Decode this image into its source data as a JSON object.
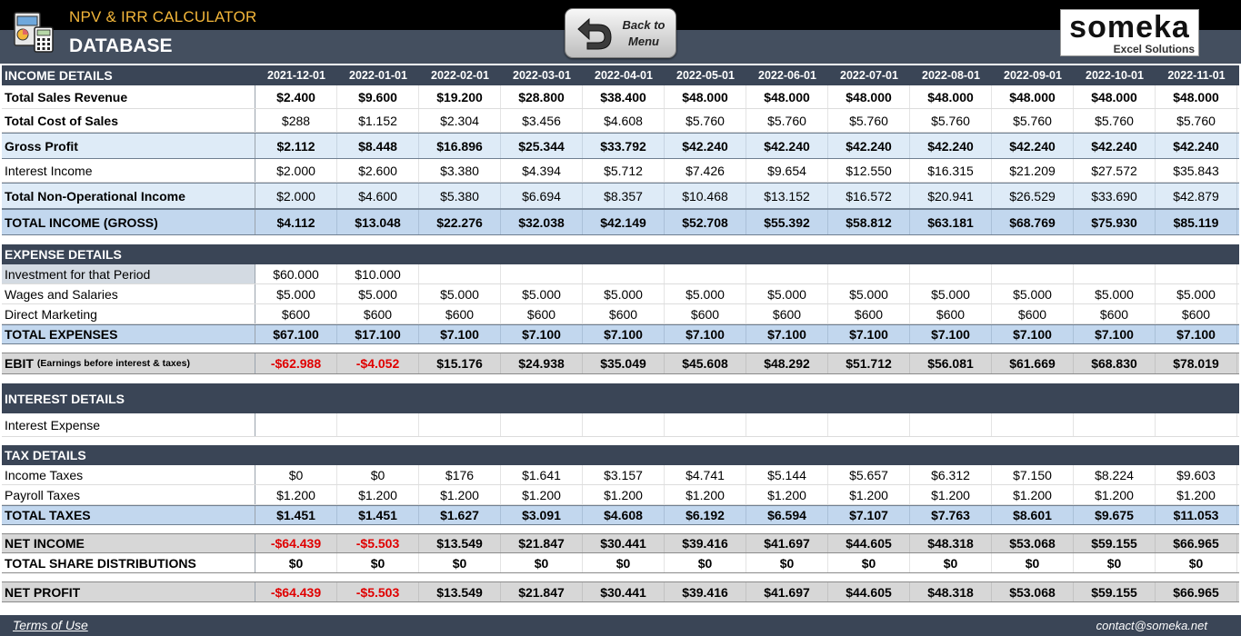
{
  "header": {
    "app_title": "NPV & IRR CALCULATOR",
    "page_title": "DATABASE",
    "back_button": "Back to\nMenu",
    "logo_word": "someka",
    "logo_sub": "Excel Solutions"
  },
  "dates": [
    "2021-12-01",
    "2022-01-01",
    "2022-02-01",
    "2022-03-01",
    "2022-04-01",
    "2022-05-01",
    "2022-06-01",
    "2022-07-01",
    "2022-08-01",
    "2022-09-01",
    "2022-10-01",
    "2022-11-01"
  ],
  "sections": [
    {
      "kind": "header",
      "label": "INCOME DETAILS",
      "show_dates": true,
      "h": 22
    },
    {
      "kind": "plain-bold",
      "label": "Total Sales Revenue",
      "h": 26,
      "values": [
        "$2.400",
        "$9.600",
        "$19.200",
        "$28.800",
        "$38.400",
        "$48.000",
        "$48.000",
        "$48.000",
        "$48.000",
        "$48.000",
        "$48.000",
        "$48.000"
      ]
    },
    {
      "kind": "plain-bold",
      "label": "Total Cost of Sales",
      "h": 26,
      "values": [
        "$288",
        "$1.152",
        "$2.304",
        "$3.456",
        "$4.608",
        "$5.760",
        "$5.760",
        "$5.760",
        "$5.760",
        "$5.760",
        "$5.760",
        "$5.760"
      ],
      "plain_values": true
    },
    {
      "kind": "light",
      "label": "Gross Profit",
      "h": 29,
      "values": [
        "$2.112",
        "$8.448",
        "$16.896",
        "$25.344",
        "$33.792",
        "$42.240",
        "$42.240",
        "$42.240",
        "$42.240",
        "$42.240",
        "$42.240",
        "$42.240"
      ]
    },
    {
      "kind": "plain",
      "label": "Interest Income",
      "h": 26,
      "values": [
        "$2.000",
        "$2.600",
        "$3.380",
        "$4.394",
        "$5.712",
        "$7.426",
        "$9.654",
        "$12.550",
        "$16.315",
        "$21.209",
        "$27.572",
        "$35.843"
      ]
    },
    {
      "kind": "light",
      "label": "Total Non-Operational Income",
      "h": 29,
      "values": [
        "$2.000",
        "$4.600",
        "$5.380",
        "$6.694",
        "$8.357",
        "$10.468",
        "$13.152",
        "$16.572",
        "$20.941",
        "$26.529",
        "$33.690",
        "$42.879"
      ],
      "plain_values": true
    },
    {
      "kind": "mid",
      "label": "TOTAL INCOME (GROSS)",
      "h": 29,
      "values": [
        "$4.112",
        "$13.048",
        "$22.276",
        "$32.038",
        "$42.149",
        "$52.708",
        "$55.392",
        "$58.812",
        "$63.181",
        "$68.769",
        "$75.930",
        "$85.119"
      ]
    },
    {
      "kind": "gap",
      "h": 10
    },
    {
      "kind": "header",
      "label": "EXPENSE DETAILS",
      "h": 22
    },
    {
      "kind": "plain",
      "label": "Investment for that Period",
      "h": 22,
      "shade_label": true,
      "values": [
        "$60.000",
        "$10.000",
        "",
        "",
        "",
        "",
        "",
        "",
        "",
        "",
        "",
        ""
      ]
    },
    {
      "kind": "plain",
      "label": "Wages and Salaries",
      "h": 22,
      "values": [
        "$5.000",
        "$5.000",
        "$5.000",
        "$5.000",
        "$5.000",
        "$5.000",
        "$5.000",
        "$5.000",
        "$5.000",
        "$5.000",
        "$5.000",
        "$5.000"
      ]
    },
    {
      "kind": "plain",
      "label": "Direct Marketing",
      "h": 22,
      "values": [
        "$600",
        "$600",
        "$600",
        "$600",
        "$600",
        "$600",
        "$600",
        "$600",
        "$600",
        "$600",
        "$600",
        "$600"
      ]
    },
    {
      "kind": "mid",
      "label": "TOTAL EXPENSES",
      "h": 22,
      "values": [
        "$67.100",
        "$17.100",
        "$7.100",
        "$7.100",
        "$7.100",
        "$7.100",
        "$7.100",
        "$7.100",
        "$7.100",
        "$7.100",
        "$7.100",
        "$7.100"
      ]
    },
    {
      "kind": "gap",
      "h": 9
    },
    {
      "kind": "gray",
      "label": "EBIT",
      "label_note": "(Earnings before interest & taxes)",
      "h": 24,
      "values": [
        "-$62.988",
        "-$4.052",
        "$15.176",
        "$24.938",
        "$35.049",
        "$45.608",
        "$48.292",
        "$51.712",
        "$56.081",
        "$61.669",
        "$68.830",
        "$78.019"
      ]
    },
    {
      "kind": "gap",
      "h": 10
    },
    {
      "kind": "header",
      "label": "INTEREST DETAILS",
      "h": 33
    },
    {
      "kind": "plain",
      "label": "Interest Expense",
      "h": 26,
      "values": [
        "",
        "",
        "",
        "",
        "",
        "",
        "",
        "",
        "",
        "",
        "",
        ""
      ]
    },
    {
      "kind": "gap",
      "h": 9
    },
    {
      "kind": "header",
      "label": "TAX DETAILS",
      "h": 22
    },
    {
      "kind": "plain",
      "label": "Income Taxes",
      "h": 22,
      "values": [
        "$0",
        "$0",
        "$176",
        "$1.641",
        "$3.157",
        "$4.741",
        "$5.144",
        "$5.657",
        "$6.312",
        "$7.150",
        "$8.224",
        "$9.603"
      ]
    },
    {
      "kind": "plain",
      "label": "Payroll Taxes",
      "h": 22,
      "values": [
        "$1.200",
        "$1.200",
        "$1.200",
        "$1.200",
        "$1.200",
        "$1.200",
        "$1.200",
        "$1.200",
        "$1.200",
        "$1.200",
        "$1.200",
        "$1.200"
      ]
    },
    {
      "kind": "mid",
      "label": "TOTAL TAXES",
      "h": 22,
      "values": [
        "$1.451",
        "$1.451",
        "$1.627",
        "$3.091",
        "$4.608",
        "$6.192",
        "$6.594",
        "$7.107",
        "$7.763",
        "$8.601",
        "$9.675",
        "$11.053"
      ]
    },
    {
      "kind": "gap",
      "h": 9
    },
    {
      "kind": "gray",
      "label": "NET INCOME",
      "h": 22,
      "values": [
        "-$64.439",
        "-$5.503",
        "$13.549",
        "$21.847",
        "$30.441",
        "$39.416",
        "$41.697",
        "$44.605",
        "$48.318",
        "$53.068",
        "$59.155",
        "$66.965"
      ]
    },
    {
      "kind": "white-b",
      "label": "TOTAL SHARE DISTRIBUTIONS",
      "h": 22,
      "values": [
        "$0",
        "$0",
        "$0",
        "$0",
        "$0",
        "$0",
        "$0",
        "$0",
        "$0",
        "$0",
        "$0",
        "$0"
      ]
    },
    {
      "kind": "gap",
      "h": 9
    },
    {
      "kind": "gray",
      "label": "NET PROFIT",
      "h": 23,
      "values": [
        "-$64.439",
        "-$5.503",
        "$13.549",
        "$21.847",
        "$30.441",
        "$39.416",
        "$41.697",
        "$44.605",
        "$48.318",
        "$53.068",
        "$59.155",
        "$66.965"
      ]
    }
  ],
  "footer": {
    "terms": "Terms of Use",
    "contact": "contact@someka.net"
  },
  "colors": {
    "header_bg": "#3a4556",
    "title_accent": "#f3b63a",
    "negative": "#e00000",
    "light_row": "#deebf7",
    "mid_row": "#c2d7ee",
    "gray_row": "#d7d7d7"
  }
}
